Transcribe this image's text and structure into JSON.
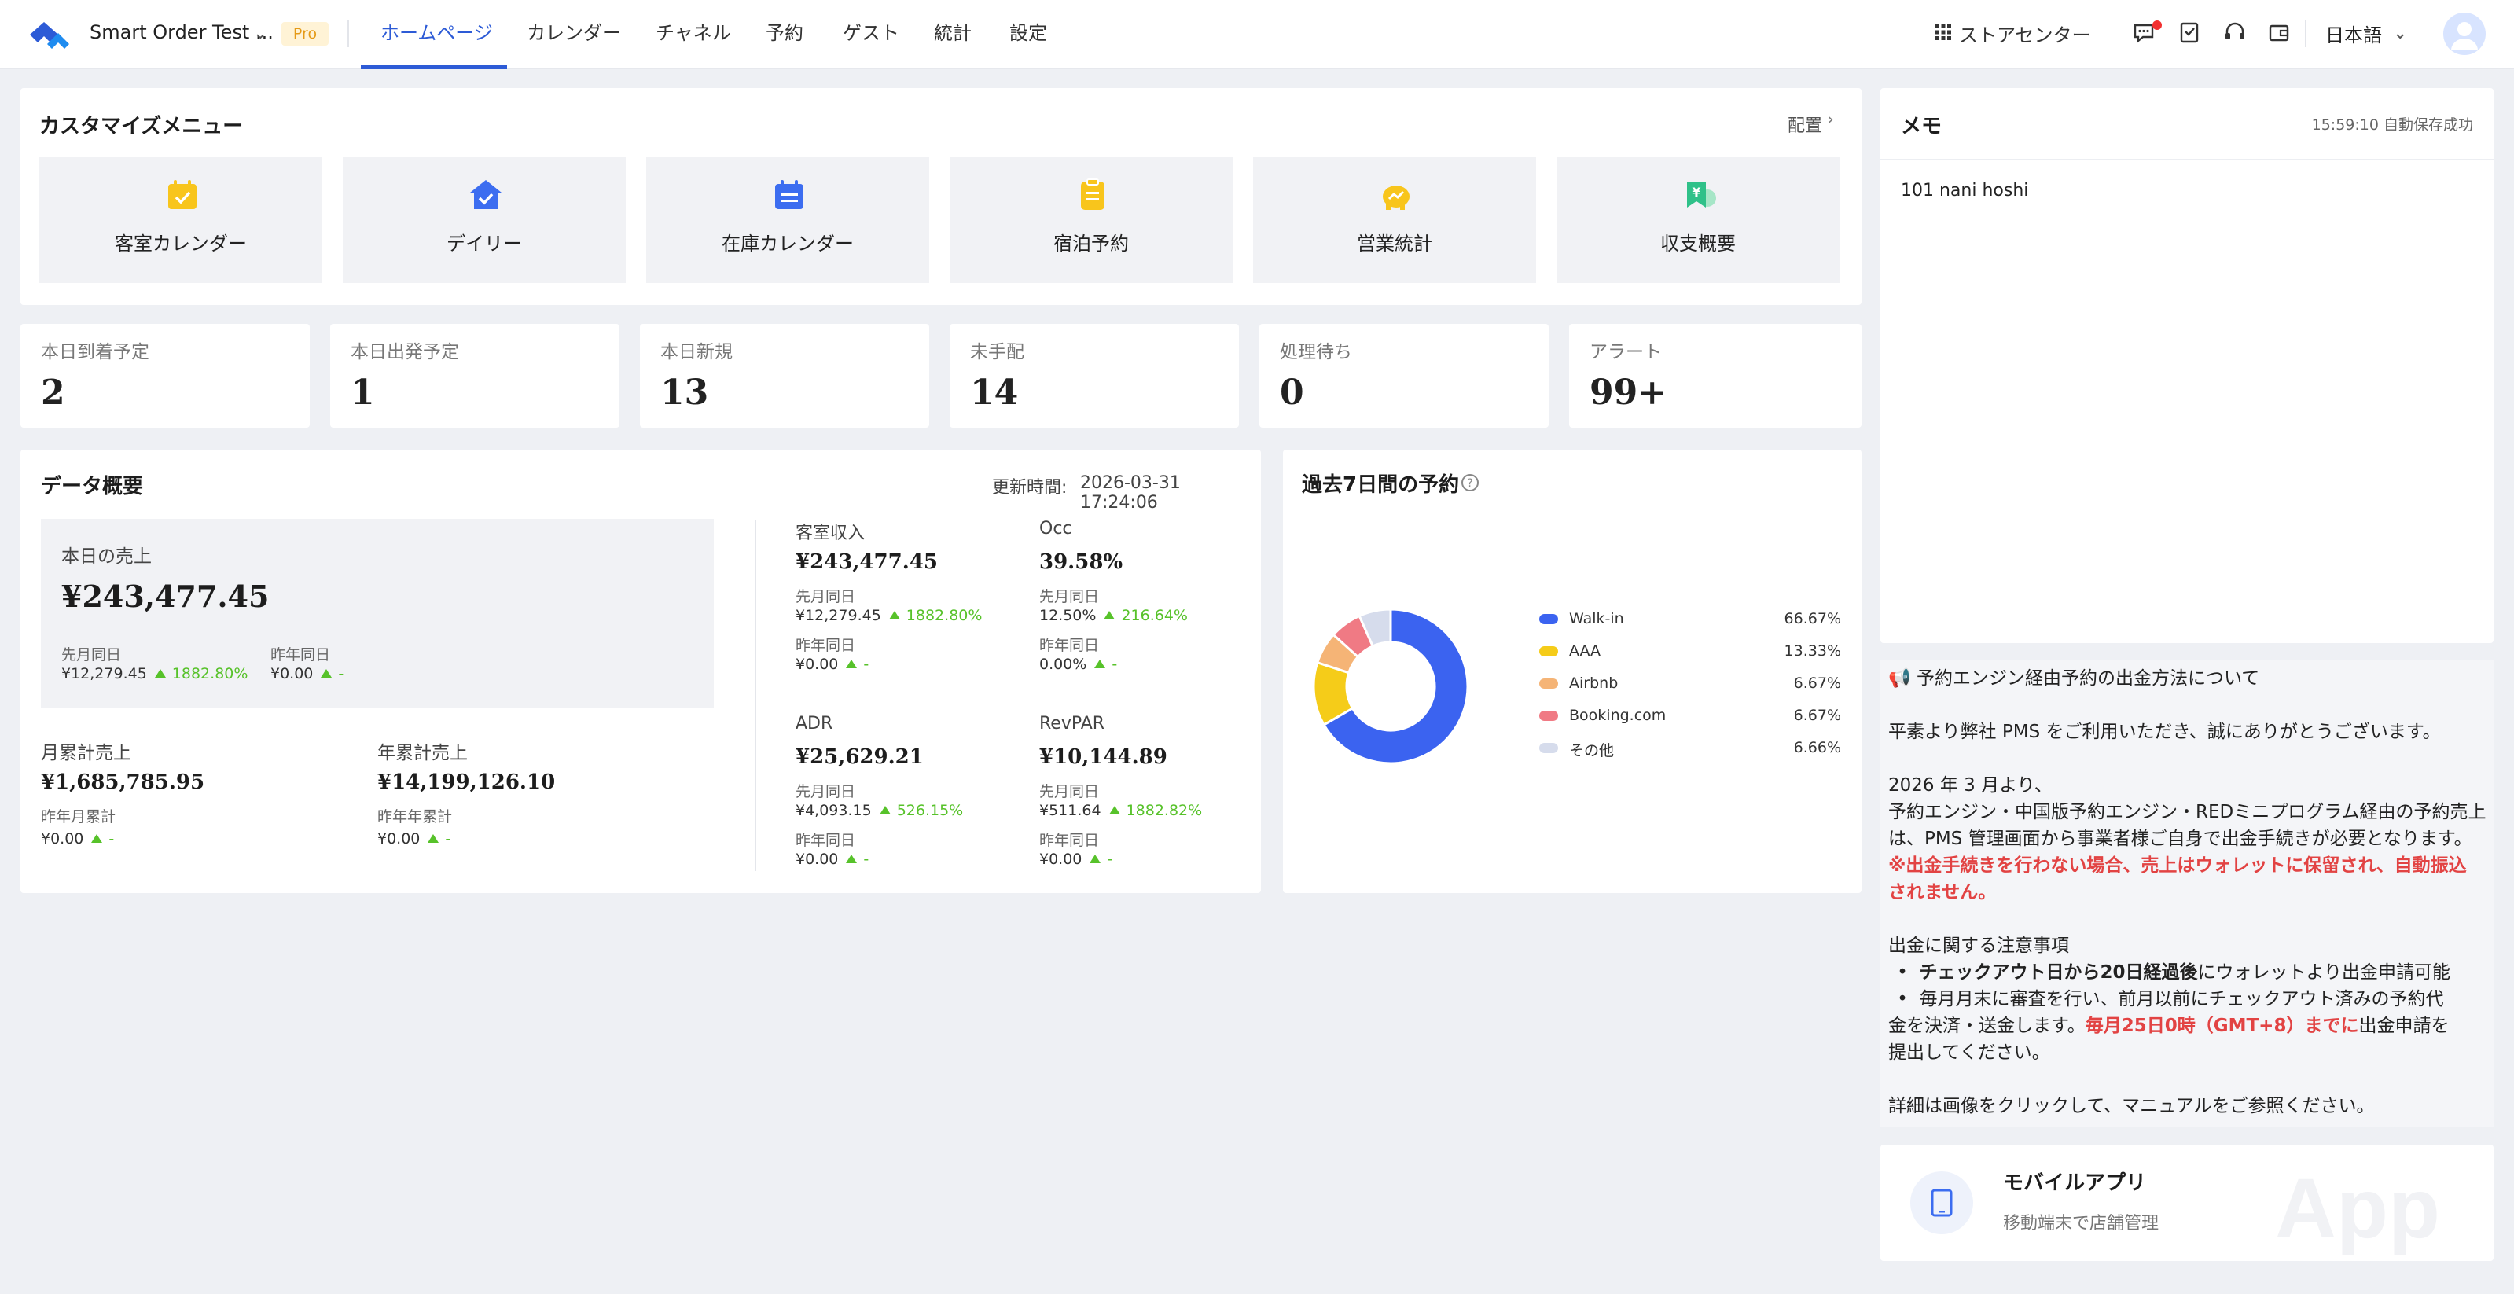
{
  "header": {
    "hotel_name": "Smart Order Test ...",
    "plan_badge": "Pro",
    "nav": [
      "ホームページ",
      "カレンダー",
      "チャネル",
      "予約",
      "ゲスト",
      "統計",
      "設定"
    ],
    "active_nav": "ホームページ",
    "store_center": "ストアセンター",
    "language": "日本語",
    "brand_color": "#2d5bd6"
  },
  "custom_menu": {
    "title": "カスタマイズメニュー",
    "configure": "配置",
    "tiles": [
      {
        "label": "客室カレンダー",
        "icon": "calendar-check-icon"
      },
      {
        "label": "デイリー",
        "icon": "house-check-icon"
      },
      {
        "label": "在庫カレンダー",
        "icon": "calendar-list-icon"
      },
      {
        "label": "宿泊予約",
        "icon": "clipboard-icon"
      },
      {
        "label": "営業統計",
        "icon": "piggy-bank-icon"
      },
      {
        "label": "収支概要",
        "icon": "yen-ticket-icon"
      }
    ]
  },
  "stats": [
    {
      "label": "本日到着予定",
      "value": "2"
    },
    {
      "label": "本日出発予定",
      "value": "1"
    },
    {
      "label": "本日新規",
      "value": "13"
    },
    {
      "label": "未手配",
      "value": "14"
    },
    {
      "label": "処理待ち",
      "value": "0"
    },
    {
      "label": "アラート",
      "value": "99+"
    }
  ],
  "overview": {
    "title": "データ概要",
    "updated_label": "更新時間:",
    "updated": "2026-03-31 17:24:06",
    "today_sales": {
      "label": "本日の売上",
      "value": "¥243,477.45",
      "prev_month_label": "先月同日",
      "prev_month_value": "¥12,279.45",
      "prev_month_change": "1882.80%",
      "prev_year_label": "昨年同日",
      "prev_year_value": "¥0.00",
      "prev_year_change": "-"
    },
    "monthly": {
      "label": "月累計売上",
      "value": "¥1,685,785.95",
      "cmp_label": "昨年月累計",
      "cmp_value": "¥0.00",
      "cmp_change": "-"
    },
    "yearly": {
      "label": "年累計売上",
      "value": "¥14,199,126.10",
      "cmp_label": "昨年年累計",
      "cmp_value": "¥0.00",
      "cmp_change": "-"
    },
    "metrics": [
      {
        "label": "客室収入",
        "value": "¥243,477.45",
        "m_label": "先月同日",
        "m_value": "¥12,279.45",
        "m_change": "1882.80%",
        "y_label": "昨年同日",
        "y_value": "¥0.00",
        "y_change": "-"
      },
      {
        "label": "Occ",
        "value": "39.58%",
        "m_label": "先月同日",
        "m_value": "12.50%",
        "m_change": "216.64%",
        "y_label": "昨年同日",
        "y_value": "0.00%",
        "y_change": "-"
      },
      {
        "label": "ADR",
        "value": "¥25,629.21",
        "m_label": "先月同日",
        "m_value": "¥4,093.15",
        "m_change": "526.15%",
        "y_label": "昨年同日",
        "y_value": "¥0.00",
        "y_change": "-"
      },
      {
        "label": "RevPAR",
        "value": "¥10,144.89",
        "m_label": "先月同日",
        "m_value": "¥511.64",
        "m_change": "1882.82%",
        "y_label": "昨年同日",
        "y_value": "¥0.00",
        "y_change": "-"
      }
    ]
  },
  "chart_data": {
    "type": "pie",
    "title": "過去7日間の予約",
    "donut": true,
    "legend_position": "right",
    "slices": [
      {
        "name": "Walk-in",
        "value": 66.67,
        "label": "66.67%",
        "color": "#3b63f0"
      },
      {
        "name": "AAA",
        "value": 13.33,
        "label": "13.33%",
        "color": "#f5cc19"
      },
      {
        "name": "Airbnb",
        "value": 6.67,
        "label": "6.67%",
        "color": "#f5b476"
      },
      {
        "name": "Booking.com",
        "value": 6.67,
        "label": "6.67%",
        "color": "#f07a84"
      },
      {
        "name": "その他",
        "value": 6.66,
        "label": "6.66%",
        "color": "#d6dcec"
      }
    ]
  },
  "memo": {
    "title": "メモ",
    "autosave": "15:59:10 自動保存成功",
    "content": "101 nani hoshi"
  },
  "notice": {
    "title": "予約エンジン経由予約の出金方法について",
    "p1": "平素より弊社 PMS をご利用いただき、誠にありがとうございます。",
    "p2a": "2026 年 3 月より、",
    "p2b": "予約エンジン・中国版予約エンジン・REDミニプログラム経由の予約売上",
    "p2c": "は、PMS 管理画面から事業者様ご自身で出金手続きが必要となります。",
    "warn1": "※出金手続きを行わない場合、売上はウォレットに保留され、自動振込",
    "warn2": "されません。",
    "notes_title": "出金に関する注意事項",
    "b1_bold": "チェックアウト日から20日経過後",
    "b1_rest": "にウォレットより出金申請可能",
    "b2a": "毎月月末に審査を行い、前月以前にチェックアウト済みの予約代",
    "b2b_pre": "金を決済・送金します。",
    "b2b_red": "毎月25日0時（GMT+8）までに",
    "b2b_post": "出金申請を",
    "b2c": "提出してください。",
    "footer": "詳細は画像をクリックして、マニュアルをご参照ください。"
  },
  "mobile_app": {
    "title": "モバイルアプリ",
    "subtitle": "移動端末で店舗管理",
    "watermark": "App"
  }
}
